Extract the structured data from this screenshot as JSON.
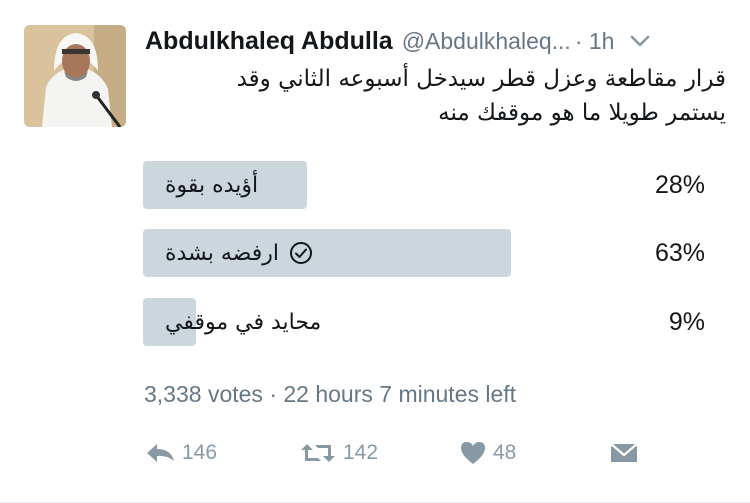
{
  "tweet": {
    "author_name": "Abdulkhaleq Abdulla",
    "author_handle": "@Abdulkhaleq...",
    "time": "· 1h",
    "text_line1": "قرار مقاطعة وعزل قطر سيدخل أسبوعه الثاني وقد",
    "text_line2": "يستمر طويلا ما هو موقفك منه",
    "icons": {
      "more": "chevron-down-icon",
      "reply": "reply-icon",
      "retweet": "retweet-icon",
      "like": "heart-icon",
      "dm": "envelope-icon",
      "selected": "check-circle-icon"
    },
    "colors": {
      "bar": "#ccd6dd",
      "text": "#14171a",
      "muted": "#657786",
      "icon": "#8899a6"
    }
  },
  "poll": {
    "options": [
      {
        "label": "أؤيده بقوة",
        "percent": "28%",
        "fraction": 0.28,
        "selected": false
      },
      {
        "label": "ارفضه بشدة",
        "percent": "63%",
        "fraction": 0.63,
        "selected": true
      },
      {
        "label": "محايد في موقفي",
        "percent": "9%",
        "fraction": 0.09,
        "selected": false
      }
    ],
    "votes": "3,338 votes",
    "separator": "·",
    "time_left": "22 hours 7 minutes left"
  },
  "actions": {
    "replies": "146",
    "retweets": "142",
    "likes": "48"
  }
}
